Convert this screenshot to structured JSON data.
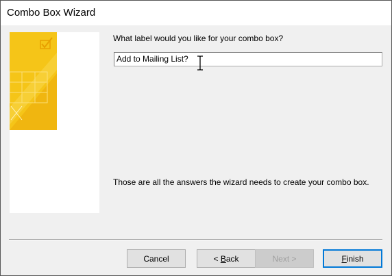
{
  "window": {
    "title": "Combo Box Wizard"
  },
  "prompt": {
    "question": "What label would you like for your combo box?",
    "label_value": "Add to Mailing List?"
  },
  "info_text": "Those are all the answers the wizard needs to create your combo box.",
  "buttons": {
    "cancel": "Cancel",
    "back_prefix": "< ",
    "back_mnemonic": "B",
    "back_suffix": "ack",
    "next": "Next >",
    "finish_mnemonic": "F",
    "finish_suffix": "inish"
  },
  "icons": {
    "illustration": "wizard-illustration-icon",
    "cursor": "ibeam-cursor-icon"
  },
  "colors": {
    "illustration_yellow": "#f5c518",
    "illustration_orange": "#e8a000",
    "focus_blue": "#0078d7"
  }
}
